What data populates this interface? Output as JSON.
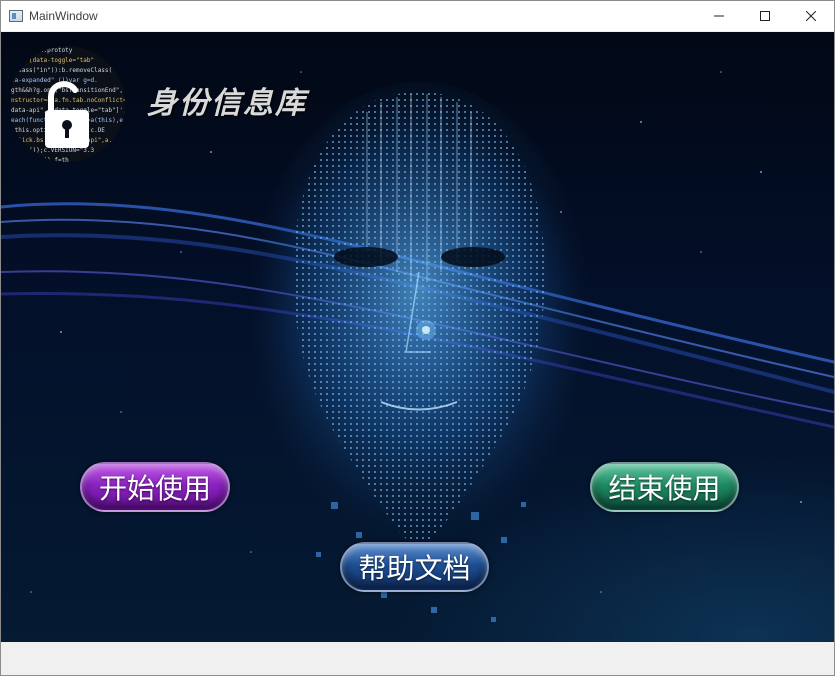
{
  "window": {
    "title": "MainWindow"
  },
  "header": {
    "app_title": "身份信息库",
    "logo_icon": "padlock-code-icon"
  },
  "buttons": {
    "start_label": "开始使用",
    "end_label": "结束使用",
    "help_label": "帮助文档"
  },
  "colors": {
    "start": "#8a23bf",
    "end": "#1f8b63",
    "help": "#1e4f93",
    "background": "#03102a"
  }
}
